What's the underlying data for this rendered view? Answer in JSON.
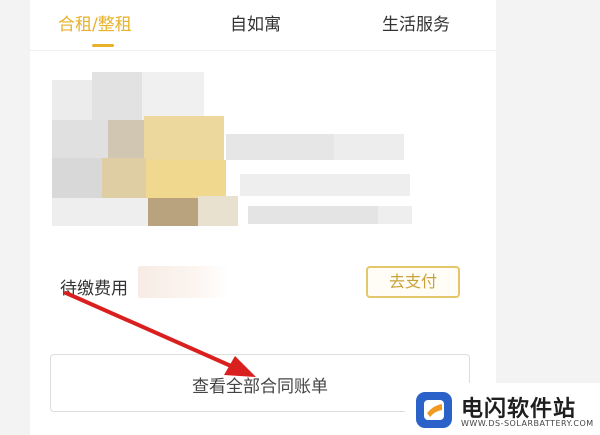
{
  "tabs": [
    {
      "label": "合租/整租",
      "active": true
    },
    {
      "label": "自如寓",
      "active": false
    },
    {
      "label": "生活服务",
      "active": false
    }
  ],
  "pending": {
    "label": "待缴费用",
    "pay_button": "去支付"
  },
  "all_bills_button": "查看全部合同账单",
  "watermark": {
    "title": "电闪软件站",
    "subtitle": "WWW.DS-SOLARBATTERY.COM"
  },
  "colors": {
    "accent": "#e7b12a",
    "arrow": "#d9201f",
    "watermark_blue": "#2a62c9",
    "watermark_orange": "#f29a1f"
  }
}
